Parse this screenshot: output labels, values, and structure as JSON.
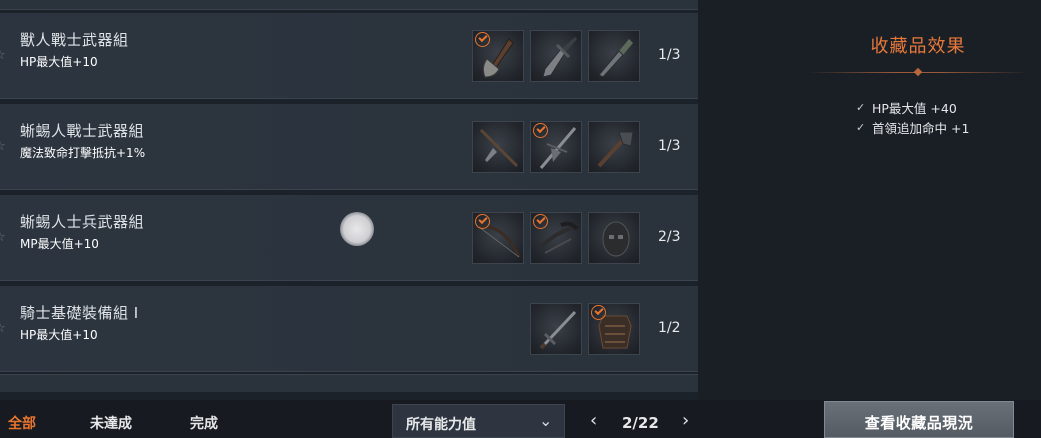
{
  "collections": [
    {
      "title": "獸人戰士武器組",
      "effect": "HP最大值+10",
      "progress": "1/3",
      "items": [
        {
          "icon": "axe-icon",
          "collected": true
        },
        {
          "icon": "broad-dagger-icon",
          "collected": false
        },
        {
          "icon": "dagger-icon",
          "collected": false
        }
      ]
    },
    {
      "title": "蜥蜴人戰士武器組",
      "effect": "魔法致命打擊抵抗+1%",
      "progress": "1/3",
      "items": [
        {
          "icon": "spear-icon",
          "collected": false
        },
        {
          "icon": "crossed-spear-icon",
          "collected": true
        },
        {
          "icon": "club-icon",
          "collected": false
        }
      ]
    },
    {
      "title": "蜥蜴人士兵武器組",
      "effect": "MP最大值+10",
      "progress": "2/3",
      "items": [
        {
          "icon": "bow-icon",
          "collected": true
        },
        {
          "icon": "crossbow-icon",
          "collected": true
        },
        {
          "icon": "helmet-icon",
          "collected": false
        }
      ]
    },
    {
      "title": "騎士基礎裝備組 I",
      "effect": "HP最大值+10",
      "progress": "1/2",
      "items": [
        {
          "icon": "sword-icon",
          "collected": false
        },
        {
          "icon": "armor-icon",
          "collected": true
        }
      ]
    }
  ],
  "side": {
    "title": "收藏品效果",
    "effects": [
      "HP最大值 +40",
      "首領追加命中 +1"
    ]
  },
  "tabs": [
    {
      "label": "全部",
      "active": true
    },
    {
      "label": "未達成",
      "active": false
    },
    {
      "label": "完成",
      "active": false
    }
  ],
  "filter": {
    "label": "所有能力值"
  },
  "pager": {
    "text": "2/22"
  },
  "view_button": {
    "label": "查看收藏品現況"
  },
  "colors": {
    "accent": "#e8752e",
    "panel": "#2c343f",
    "background": "#1a1f26"
  }
}
